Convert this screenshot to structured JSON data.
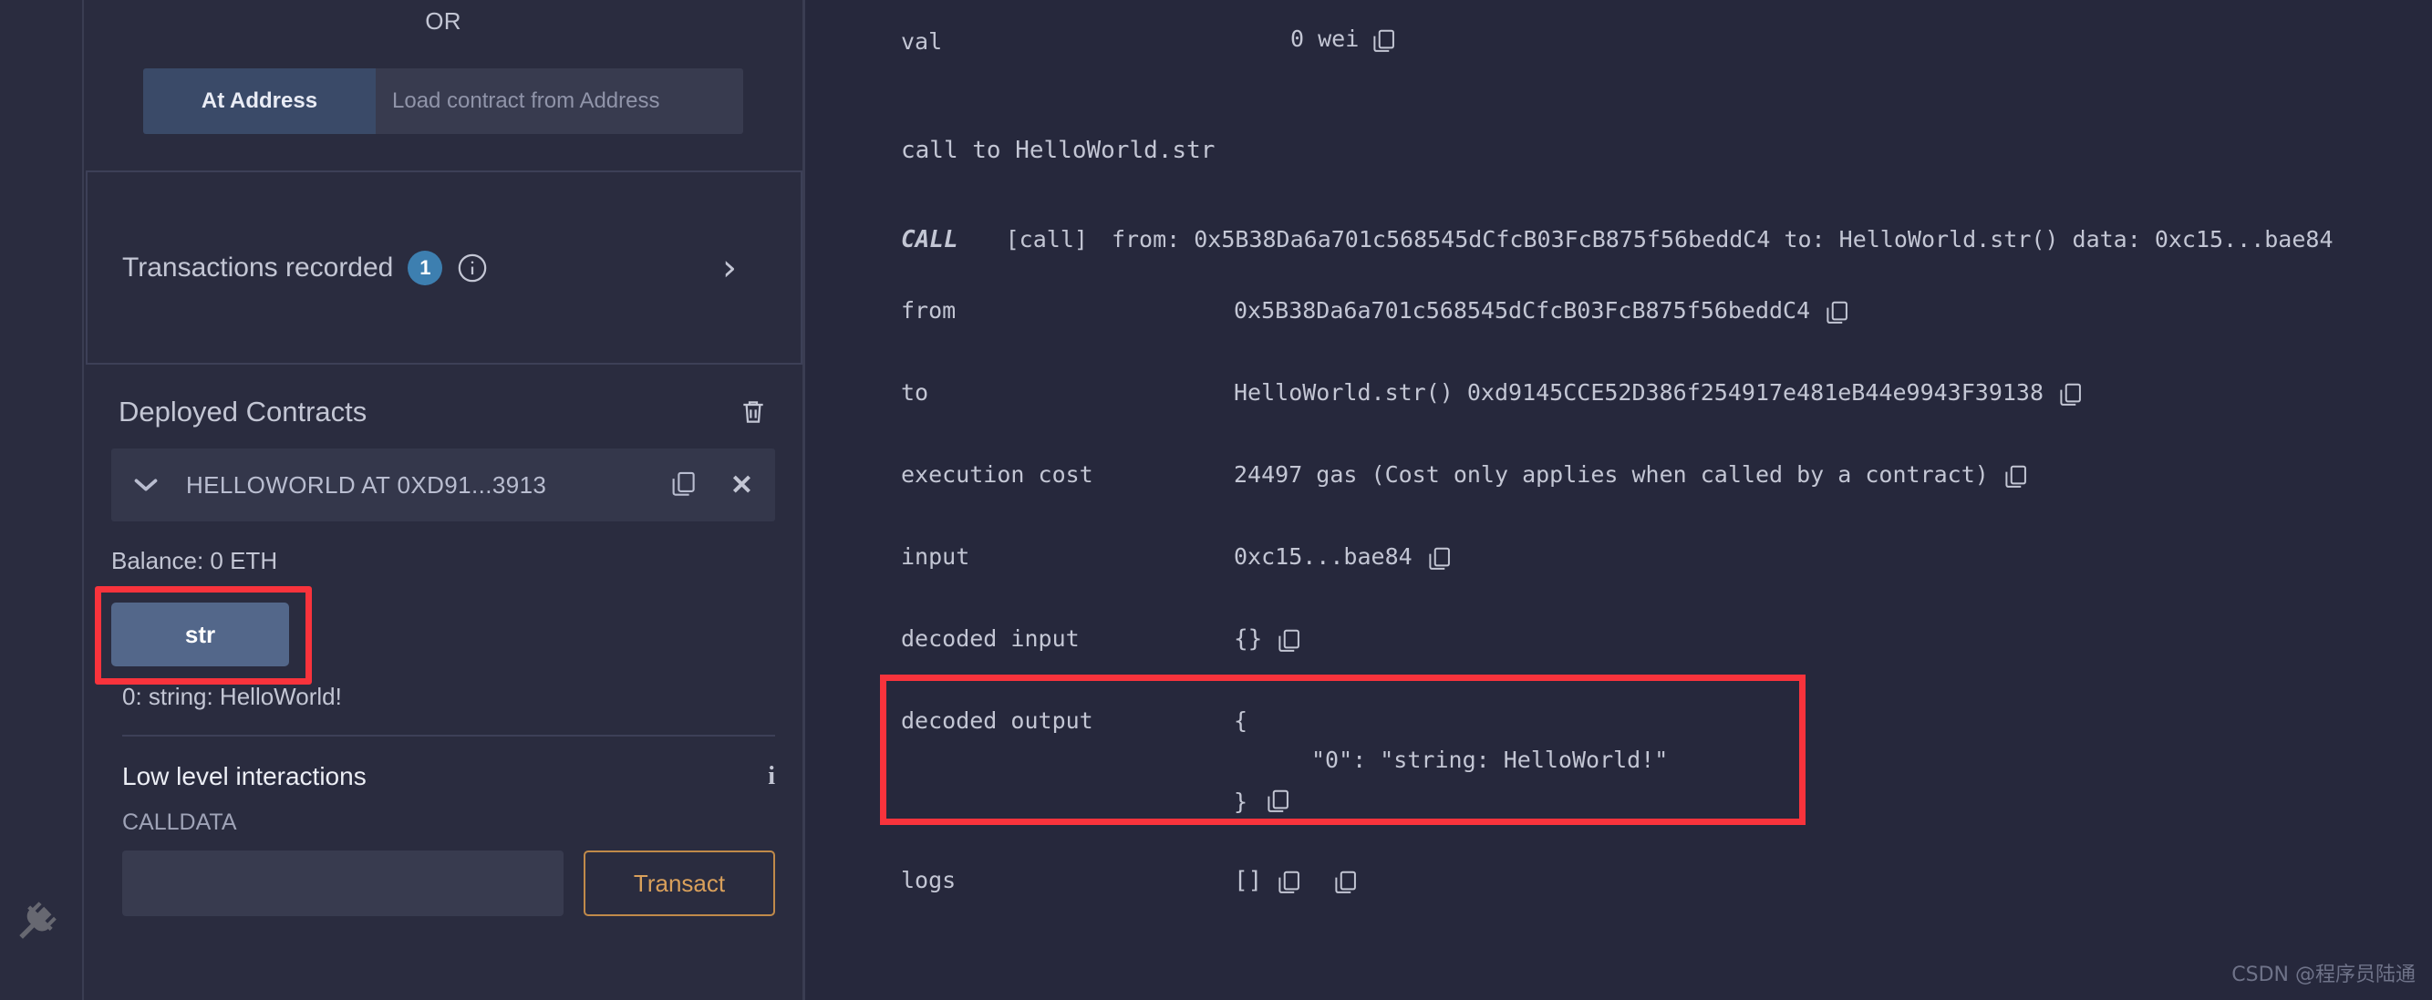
{
  "left_panel": {
    "or_label": "OR",
    "at_address_button": "At Address",
    "address_input_placeholder": "Load contract from Address",
    "address_input_value": "",
    "transactions_recorded": {
      "label": "Transactions recorded",
      "count": "1",
      "info_icon": "info-circle-icon",
      "expand_icon": "chevron-right-icon"
    },
    "deployed_contracts": {
      "title": "Deployed Contracts",
      "delete_icon": "trash-icon",
      "contract": {
        "expand_icon": "chevron-down-icon",
        "name": "HELLOWORLD AT 0XD91...3913",
        "copy_icon": "copy-icon",
        "close_icon": "close-icon",
        "balance": "Balance: 0 ETH",
        "function_button": "str",
        "function_result": "0: string: HelloWorld!"
      }
    },
    "low_level": {
      "title": "Low level interactions",
      "info_icon": "info-icon",
      "calldata_label": "CALLDATA",
      "calldata_value": "",
      "calldata_placeholder": "",
      "transact_button": "Transact"
    }
  },
  "terminal": {
    "val_row": {
      "key": "val",
      "value": "0 wei",
      "copy_icon": "copy-icon"
    },
    "call_to": "call to HelloWorld.str",
    "call_line": {
      "keyword": "CALL",
      "tag": "[call]",
      "rest": "from: 0x5B38Da6a701c568545dCfcB03FcB875f56beddC4 to: HelloWorld.str() data: 0xc15...bae84"
    },
    "rows": [
      {
        "key": "from",
        "value": "0x5B38Da6a701c568545dCfcB03FcB875f56beddC4",
        "copy_icon": "copy-icon"
      },
      {
        "key": "to",
        "value": "HelloWorld.str() 0xd9145CCE52D386f254917e481eB44e9943F39138",
        "copy_icon": "copy-icon"
      },
      {
        "key": "execution cost",
        "value": "24497 gas (Cost only applies when called by a contract)",
        "copy_icon": "copy-icon"
      },
      {
        "key": "input",
        "value": "0xc15...bae84",
        "copy_icon": "copy-icon"
      },
      {
        "key": "decoded input",
        "value": "{}",
        "copy_icon": "copy-icon"
      }
    ],
    "decoded_output": {
      "key": "decoded output",
      "line1": "{",
      "line2": "\"0\": \"string: HelloWorld!\"",
      "line3": "}",
      "copy_icon": "copy-icon"
    },
    "logs": {
      "key": "logs",
      "value": "[]",
      "copy_icon_1": "copy-icon",
      "copy_icon_2": "copy-icon"
    }
  },
  "watermark": "CSDN @程序员陆通",
  "colors": {
    "accent_blue": "#3d7fb0",
    "button_blue": "#53678a",
    "highlight_red": "#f8333c",
    "transact_orange": "#d9a05b",
    "panel_bg": "#2a2c3f",
    "terminal_bg": "#26283c"
  }
}
